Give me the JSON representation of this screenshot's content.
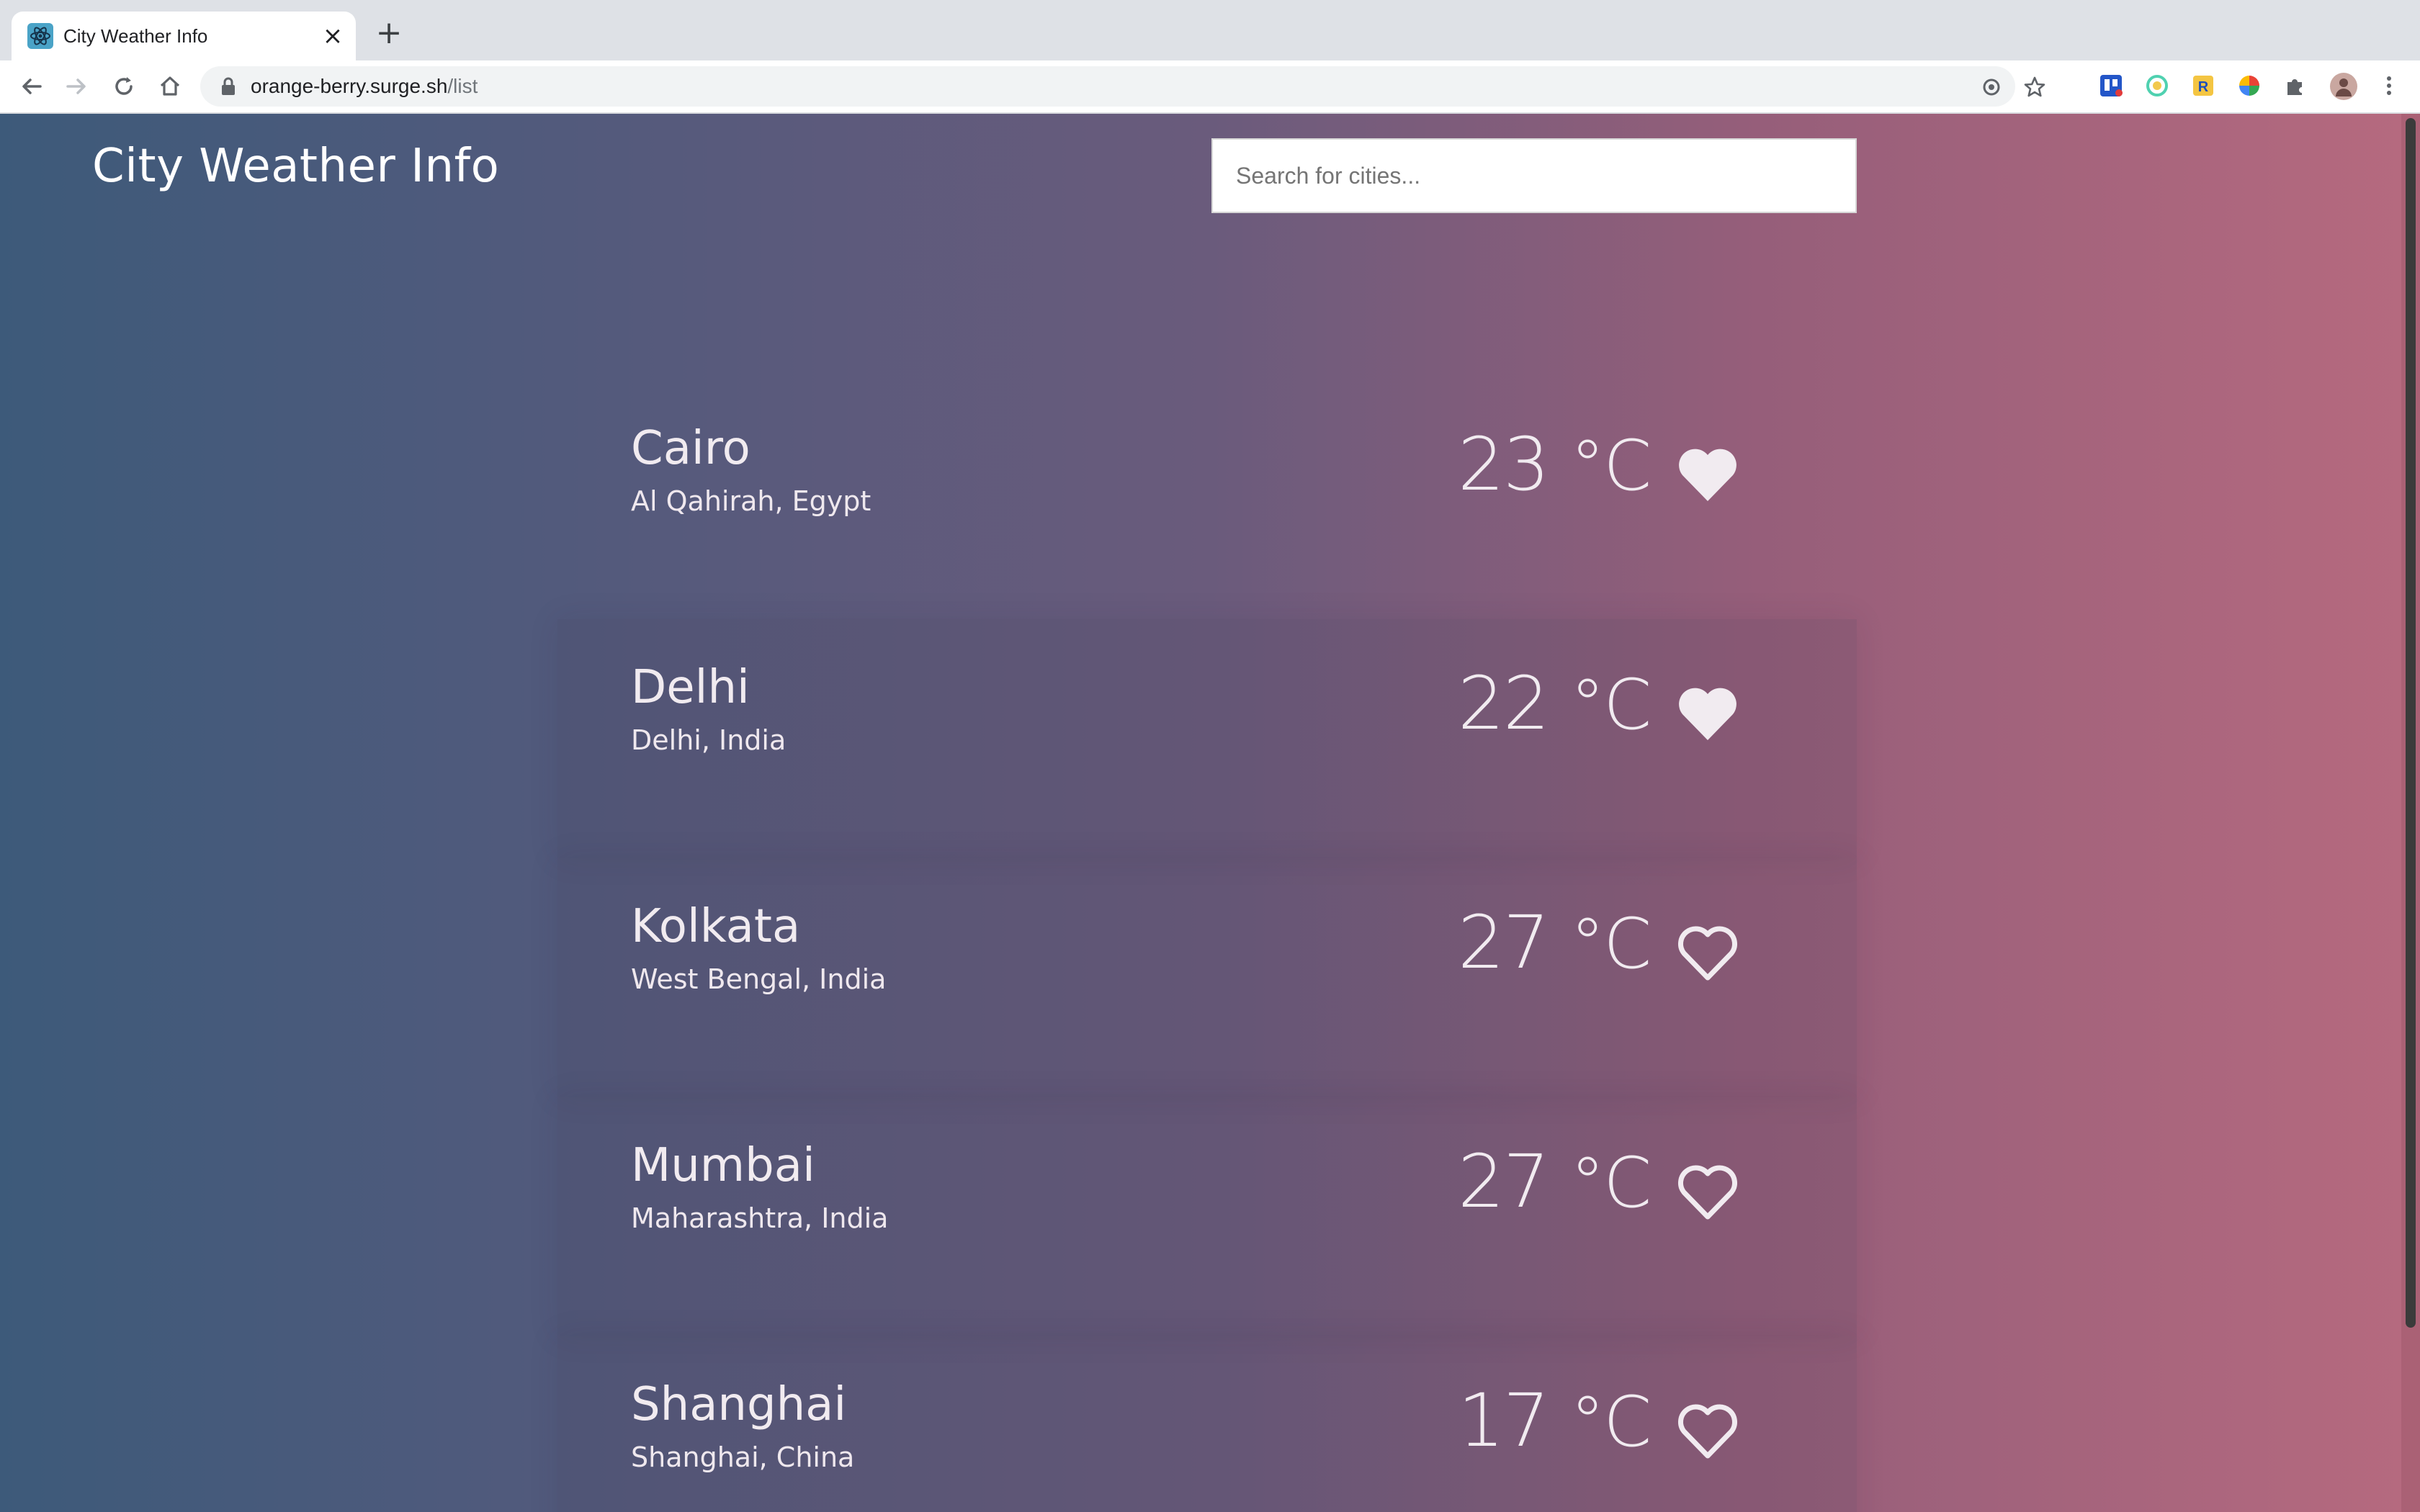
{
  "browser": {
    "tab_title": "City Weather Info",
    "tab_close": "×",
    "new_tab": "+",
    "url_host": "orange-berry.surge.sh",
    "url_path": "/list"
  },
  "app": {
    "title": "City Weather Info",
    "search_placeholder": "Search for cities..."
  },
  "cities": [
    {
      "name": "Cairo",
      "region": "Al Qahirah, Egypt",
      "temp": "23",
      "unit": "°C",
      "favorite": true
    },
    {
      "name": "Delhi",
      "region": "Delhi, India",
      "temp": "22",
      "unit": "°C",
      "favorite": true
    },
    {
      "name": "Kolkata",
      "region": "West Bengal, India",
      "temp": "27",
      "unit": "°C",
      "favorite": false
    },
    {
      "name": "Mumbai",
      "region": "Maharashtra, India",
      "temp": "27",
      "unit": "°C",
      "favorite": false
    },
    {
      "name": "Shanghai",
      "region": "Shanghai, China",
      "temp": "17",
      "unit": "°C",
      "favorite": false
    }
  ],
  "colors": {
    "text": "#f1ebf0",
    "gradient_left": "#3d5a7a",
    "gradient_right": "#b66a7f"
  }
}
